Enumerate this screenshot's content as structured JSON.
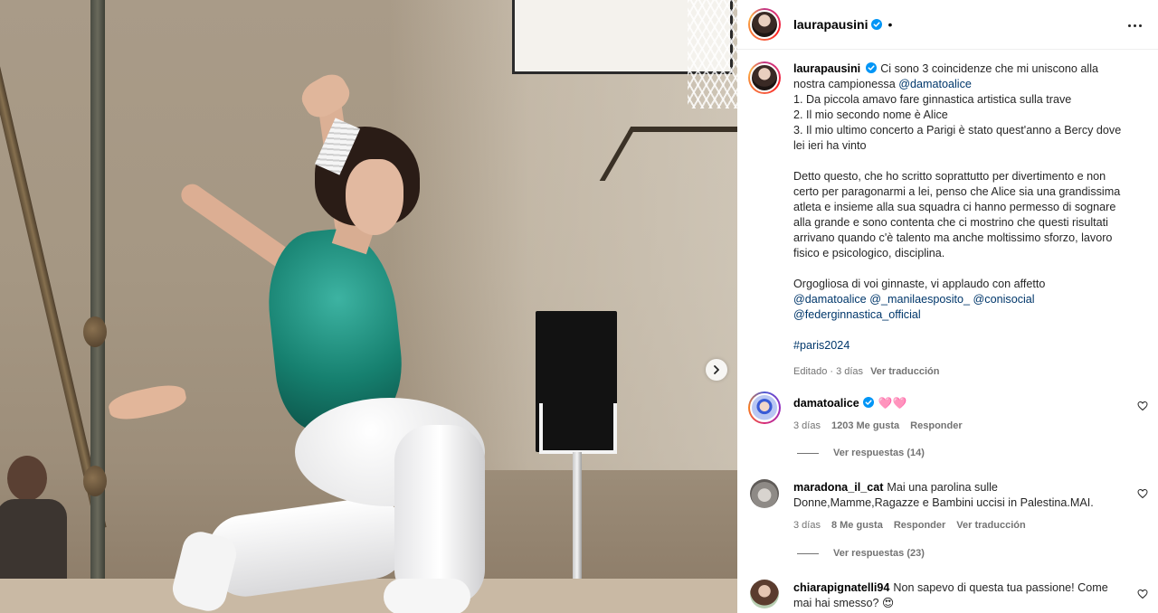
{
  "post": {
    "username": "laurapausini",
    "dot": "•"
  },
  "caption": {
    "username": "laurapausini",
    "line1": "Ci sono 3 coincidenze che mi uniscono alla nostra campionessa",
    "line1_mention": "@damatoalice",
    "item1": "1. Da piccola amavo fare ginnastica artistica sulla trave",
    "item2": "2. Il mio secondo nome è Alice",
    "item3": "3. Il mio ultimo concerto a Parigi è stato quest'anno a Bercy dove lei ieri ha vinto",
    "para2": "Detto questo, che ho scritto soprattutto per divertimento e non certo per paragonarmi a lei, penso che Alice sia una grandissima atleta e insieme alla sua squadra ci hanno permesso di sognare alla grande e sono contenta che ci mostrino che questi risultati arrivano quando c'è talento ma anche moltissimo sforzo, lavoro fisico e psicologico, disciplina.",
    "para3": "Orgogliosa di voi ginnaste, vi applaudo con affetto",
    "mentions": [
      "@damatoalice",
      "@_manilaesposito_",
      "@conisocial",
      "@federginnastica_official"
    ],
    "hashtag": "#paris2024",
    "edited": "Editado · 3 días",
    "translate": "Ver traducción"
  },
  "comments": [
    {
      "username": "damatoalice",
      "text": "🩷🩷",
      "age": "3 días",
      "likes": "1203 Me gusta",
      "reply": "Responder",
      "view_replies": "Ver respuestas (14)"
    },
    {
      "username": "maradona_il_cat",
      "text": "Mai una parolina sulle Donne,Mamme,Ragazze e Bambini uccisi in Palestina.MAI.",
      "age": "3 días",
      "likes": "8 Me gusta",
      "reply": "Responder",
      "translate": "Ver traducción",
      "view_replies": "Ver respuestas (23)"
    },
    {
      "username": "chiarapignatelli94",
      "text": "Non sapevo di questa tua passione! Come mai hai smesso? 😍"
    }
  ],
  "icons": {
    "verified": "verified-badge-icon",
    "more": "more-options-icon",
    "heart": "heart-outline-icon",
    "next": "chevron-right-icon"
  },
  "colors": {
    "link": "#00376b",
    "verified": "#0095f6",
    "meta": "#737373"
  }
}
